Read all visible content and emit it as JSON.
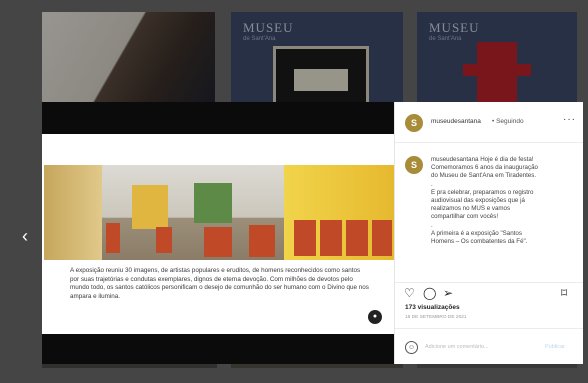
{
  "background_thumbs": {
    "logo_text": "MUSEU",
    "logo_sub": "de Sant'Ana"
  },
  "post": {
    "username": "museudesantana",
    "separator": "•",
    "following": "Seguindo",
    "more": "···",
    "avatar_letter": "S",
    "caption_lines": [
      "museudesantana Hoje é dia de festa!",
      "Comemoramos 6 anos da inauguração",
      "do Museu de Sant'Ana em Tiradentes.",
      ".",
      "E pra celebrar, preparamos o registro",
      "audiovisual das exposições que já",
      "realizamos no MUS e vamos",
      "compartilhar com vocês!",
      ".",
      "A primeira é a exposição \"Santos",
      "Homens – Os combatentes da Fé\"."
    ],
    "media_caption": "A exposição reuniu 30 imagens, de artistas populares e eruditos, de homens reconhecidos como santos por suas trajetórias e condutas exemplares, dignos de eterna devoção. Com milhões de devotos pelo mundo todo, os santos católicos personificam o desejo de comunhão do ser humano com o Divino que nos ampara e ilumina.",
    "views": "173 visualizações",
    "date": "16 DE SETEMBRO DE 2021",
    "add_comment_placeholder": "Adicione um comentário...",
    "publish": "Publicar",
    "icons": {
      "like": "heart-icon",
      "comment": "comment-icon",
      "share": "share-icon",
      "save": "bookmark-icon",
      "emoji": "emoji-icon",
      "prev": "chevron-left-icon",
      "more_media": "more-dots-icon"
    }
  },
  "colors": {
    "avatar": "#a88c3a",
    "overlay": "#000000",
    "link_disabled": "#bcd6ef"
  }
}
